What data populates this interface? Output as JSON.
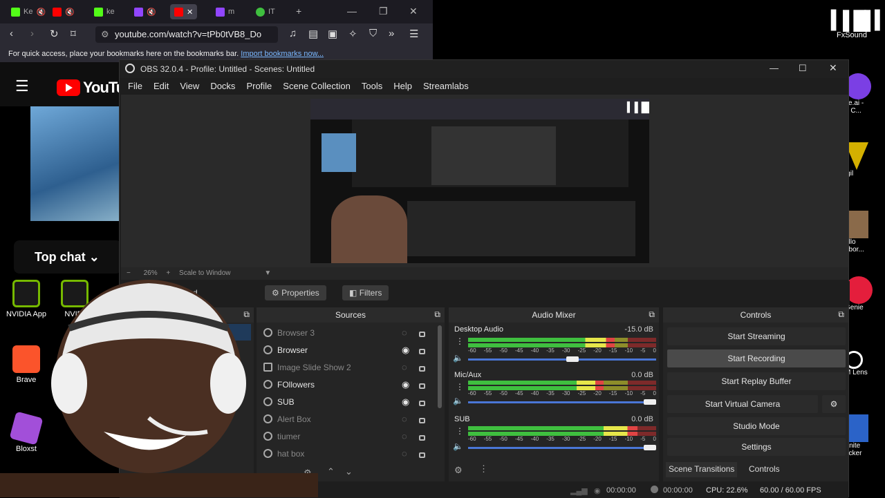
{
  "browser": {
    "tabs": [
      {
        "label": "Ke",
        "color": "#53fc18"
      },
      {
        "label": "",
        "color": "#ff0000"
      },
      {
        "label": "ke",
        "color": "#53fc18"
      },
      {
        "label": "",
        "color": "#9146ff"
      },
      {
        "label": "",
        "color": "#ff0000"
      },
      {
        "label": "m",
        "color": "#9146ff"
      },
      {
        "label": "IT",
        "color": "#3fbf3f"
      }
    ],
    "url": "youtube.com/watch?v=tPb0tVB8_Do",
    "bookmarks_text": "For quick access, place your bookmarks here on the bookmarks bar.",
    "bookmarks_link": "Import bookmarks now..."
  },
  "youtube": {
    "logo": "YouTu",
    "top_chat": "Top chat"
  },
  "desktop": {
    "left_icons": [
      {
        "label": "NVIDIA App",
        "color": "#76b900"
      },
      {
        "label": "NVIDI",
        "color": "#76b900"
      },
      {
        "label": "Brave",
        "color": "#fb542b"
      },
      {
        "label": "Bloxst",
        "color": "#a24fd9"
      }
    ],
    "right_icons": [
      {
        "label": "FxSound"
      },
      {
        "label": "ce.ai -\ne C..."
      },
      {
        "label": "igil"
      },
      {
        "label": "ello\nhbor..."
      },
      {
        "label": "Genie"
      },
      {
        "label": "M Lens"
      },
      {
        "label": "rtnite\nacker"
      }
    ]
  },
  "obs": {
    "title": "OBS 32.0.4 - Profile: Untitled - Scenes: Untitled",
    "menu": [
      "File",
      "Edit",
      "View",
      "Docks",
      "Profile",
      "Scene Collection",
      "Tools",
      "Help",
      "Streamlabs"
    ],
    "zoom": "26%",
    "scale_mode": "Scale to Window",
    "no_source": "No source selected",
    "properties_label": "Properties",
    "filters_label": "Filters",
    "docks": {
      "sources": "Sources",
      "audio_mixer": "Audio Mixer",
      "controls": "Controls"
    },
    "sources": [
      {
        "name": "Browser 3",
        "visible": false
      },
      {
        "name": "Browser",
        "visible": true
      },
      {
        "name": "Image Slide Show 2",
        "visible": false
      },
      {
        "name": "FOllowers",
        "visible": true
      },
      {
        "name": "SUB",
        "visible": true
      },
      {
        "name": "Alert Box",
        "visible": false
      },
      {
        "name": "tiumer",
        "visible": false
      },
      {
        "name": "hat box",
        "visible": false
      }
    ],
    "mixer": {
      "ticks": [
        "-60",
        "-55",
        "-50",
        "-45",
        "-40",
        "-35",
        "-30",
        "-25",
        "-20",
        "-15",
        "-10",
        "-5",
        "0"
      ],
      "channels": [
        {
          "name": "Desktop Audio",
          "db": "-15.0 dB",
          "level": 0.78,
          "volume": 0.56
        },
        {
          "name": "Mic/Aux",
          "db": "0.0 dB",
          "level": 0.72,
          "volume": 1.0
        },
        {
          "name": "SUB",
          "db": "0.0 dB",
          "level": 0.9,
          "volume": 1.0
        }
      ]
    },
    "controls": {
      "start_streaming": "Start Streaming",
      "start_recording": "Start Recording",
      "start_replay_buffer": "Start Replay Buffer",
      "start_virtual_camera": "Start Virtual Camera",
      "studio_mode": "Studio Mode",
      "settings": "Settings"
    },
    "bottom_tabs": [
      "Scene Transitions",
      "Controls"
    ],
    "status": {
      "stream_time": "00:00:00",
      "record_time": "00:00:00",
      "cpu": "CPU: 22.6%",
      "fps": "60.00 / 60.00 FPS"
    }
  }
}
